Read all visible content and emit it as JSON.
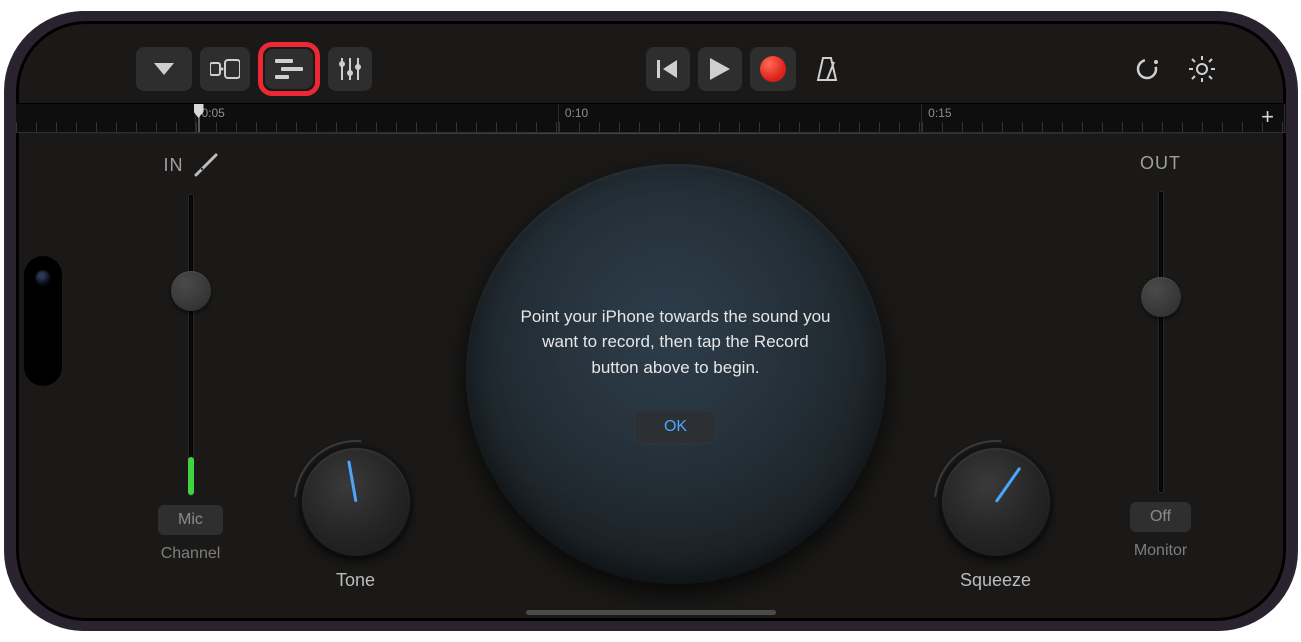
{
  "toolbar": {
    "icons": {
      "my_songs": "chevron-down-icon",
      "browser": "instrument-browser-icon",
      "tracks": "tracks-view-icon",
      "controls": "track-controls-icon",
      "rewind": "go-to-beginning-icon",
      "play": "play-icon",
      "record": "record-icon",
      "metronome": "metronome-icon",
      "loop": "loop-icon",
      "settings": "settings-icon"
    }
  },
  "ruler": {
    "marks": [
      "",
      "0:05",
      "0:10",
      "0:15"
    ]
  },
  "in": {
    "label": "IN",
    "chip": "Mic",
    "sub": "Channel"
  },
  "out": {
    "label": "OUT",
    "chip": "Off",
    "sub": "Monitor"
  },
  "knobs": {
    "tone": "Tone",
    "squeeze": "Squeeze"
  },
  "hint": {
    "text": "Point your iPhone towards the sound you want to record, then tap the Record button above to begin.",
    "ok": "OK"
  },
  "colors": {
    "accent_red": "#eb2834",
    "accent_blue": "#4aa6ff",
    "record": "#e0261c"
  }
}
